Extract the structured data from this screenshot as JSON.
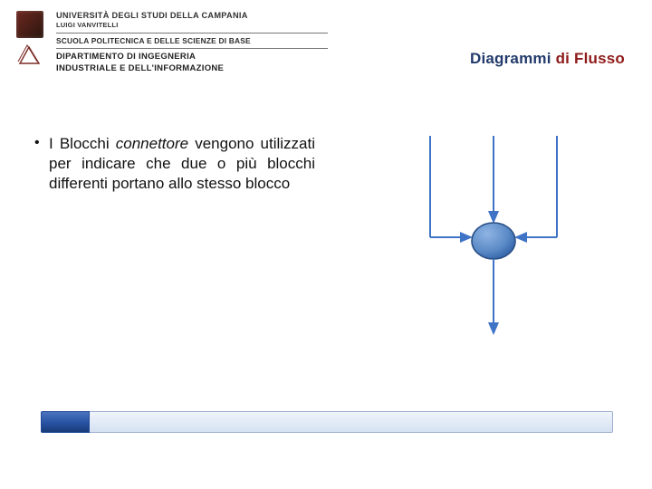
{
  "header": {
    "university": "UNIVERSITÀ DEGLI STUDI DELLA CAMPANIA",
    "university_sub": "LUIGI VANVITELLI",
    "school": "SCUOLA POLITECNICA E DELLE SCIENZE DI BASE",
    "department_line1": "DIPARTIMENTO DI INGEGNERIA",
    "department_line2": "INDUSTRIALE E DELL'INFORMAZIONE"
  },
  "title": {
    "part1": "Diagrammi",
    "part2": "di Flusso"
  },
  "bullet": {
    "prefix": "I Blocchi ",
    "keyword": "connettore",
    "rest": " vengono utilizzati per indicare che due o più blocchi differenti portano allo stesso blocco"
  },
  "colors": {
    "title_blue": "#223a6b",
    "title_red": "#8f1a1a",
    "connector_fill": "#5b8ac6",
    "connector_stroke": "#2b4f86",
    "arrow": "#3f73c6"
  }
}
